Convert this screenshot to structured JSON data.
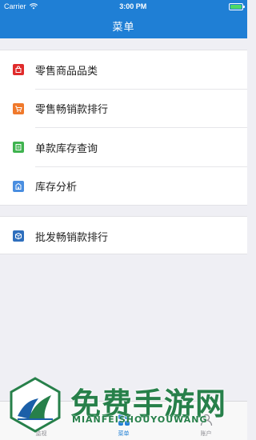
{
  "status_bar": {
    "carrier": "Carrier",
    "time": "3:00 PM"
  },
  "navbar": {
    "title": "菜单"
  },
  "menu_group_1": [
    {
      "label": "零售商品品类",
      "icon": "bag-icon",
      "color": "#e02b2b"
    },
    {
      "label": "零售畅销款排行",
      "icon": "cart-icon",
      "color": "#f0792b"
    },
    {
      "label": "单款库存查询",
      "icon": "document-icon",
      "color": "#3fb34f"
    },
    {
      "label": "库存分析",
      "icon": "building-icon",
      "color": "#4a8ee0"
    }
  ],
  "menu_group_2": [
    {
      "label": "批发畅销款排行",
      "icon": "box-icon",
      "color": "#2f6fbd"
    }
  ],
  "tabbar": [
    {
      "label": "监视",
      "icon": "monitor-icon",
      "active": false
    },
    {
      "label": "菜单",
      "icon": "grid-icon",
      "active": true
    },
    {
      "label": "账户",
      "icon": "account-icon",
      "active": false
    }
  ],
  "watermark": {
    "title": "免费手游网",
    "subtitle": "MIANFEISHOUYOUWANG"
  },
  "colors": {
    "primary": "#1f7fd5",
    "background": "#efeff4"
  }
}
